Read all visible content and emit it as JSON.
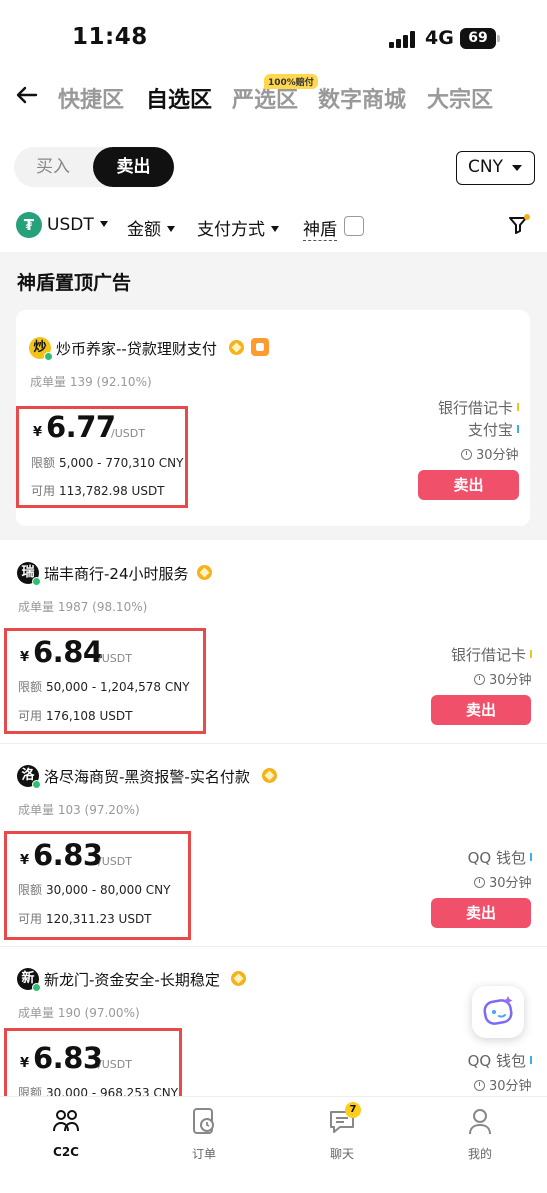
{
  "status_bar": {
    "time": "11:48",
    "network": "4G",
    "battery": "69"
  },
  "nav": {
    "tabs": [
      "快捷区",
      "自选区",
      "严选区",
      "数字商城",
      "大宗区"
    ],
    "active_tab": "自选区",
    "badge": "100%赔付"
  },
  "trade_toggle": {
    "buy": "买入",
    "sell": "卖出",
    "active": "卖出"
  },
  "currency": "CNY",
  "filters": {
    "coin": "USDT",
    "amount": "金额",
    "payment": "支付方式",
    "shield": "神盾"
  },
  "section_title": "神盾置顶广告",
  "ads": [
    {
      "avatar_char": "炒",
      "avatar_color": "#f2c318",
      "merchant": "炒币养家--贷款理财支付",
      "volume": "成单量 139 (92.10%)",
      "currency_symbol": "¥",
      "price": "6.77",
      "unit": "/USDT",
      "limit_label": "限额",
      "limit": "5,000 - 770,310 CNY",
      "available_label": "可用",
      "available": "113,782.98 USDT",
      "payments": [
        "银行借记卡",
        "支付宝"
      ],
      "time_limit": "30分钟",
      "action": "卖出"
    },
    {
      "avatar_char": "瑞",
      "avatar_color": "#111111",
      "merchant": "瑞丰商行-24小时服务",
      "volume": "成单量 1987 (98.10%)",
      "currency_symbol": "¥",
      "price": "6.84",
      "unit": "/USDT",
      "limit_label": "限额",
      "limit": "50,000 - 1,204,578 CNY",
      "available_label": "可用",
      "available": "176,108 USDT",
      "payments": [
        "银行借记卡"
      ],
      "time_limit": "30分钟",
      "action": "卖出"
    },
    {
      "avatar_char": "洛",
      "avatar_color": "#111111",
      "merchant": "洛尽海商贸-黑资报警-实名付款",
      "volume": "成单量 103 (97.20%)",
      "currency_symbol": "¥",
      "price": "6.83",
      "unit": "/USDT",
      "limit_label": "限额",
      "limit": "30,000 - 80,000 CNY",
      "available_label": "可用",
      "available": "120,311.23 USDT",
      "payments": [
        "QQ 钱包"
      ],
      "time_limit": "30分钟",
      "action": "卖出"
    },
    {
      "avatar_char": "新",
      "avatar_color": "#111111",
      "merchant": "新龙门-资金安全-长期稳定",
      "volume": "成单量 190 (97.00%)",
      "currency_symbol": "¥",
      "price": "6.83",
      "unit": "/USDT",
      "limit_label": "限额",
      "limit": "30,000 - 968,253 CNY",
      "payments": [
        "QQ 钱包"
      ],
      "time_limit": "30分钟"
    }
  ],
  "tabbar": {
    "items": [
      "C2C",
      "订单",
      "聊天",
      "我的"
    ],
    "active": "C2C",
    "chat_badge": "7"
  },
  "colors": {
    "accent": "#f0506a",
    "highlight_box": "#e84a4a",
    "tether": "#26a17b"
  }
}
